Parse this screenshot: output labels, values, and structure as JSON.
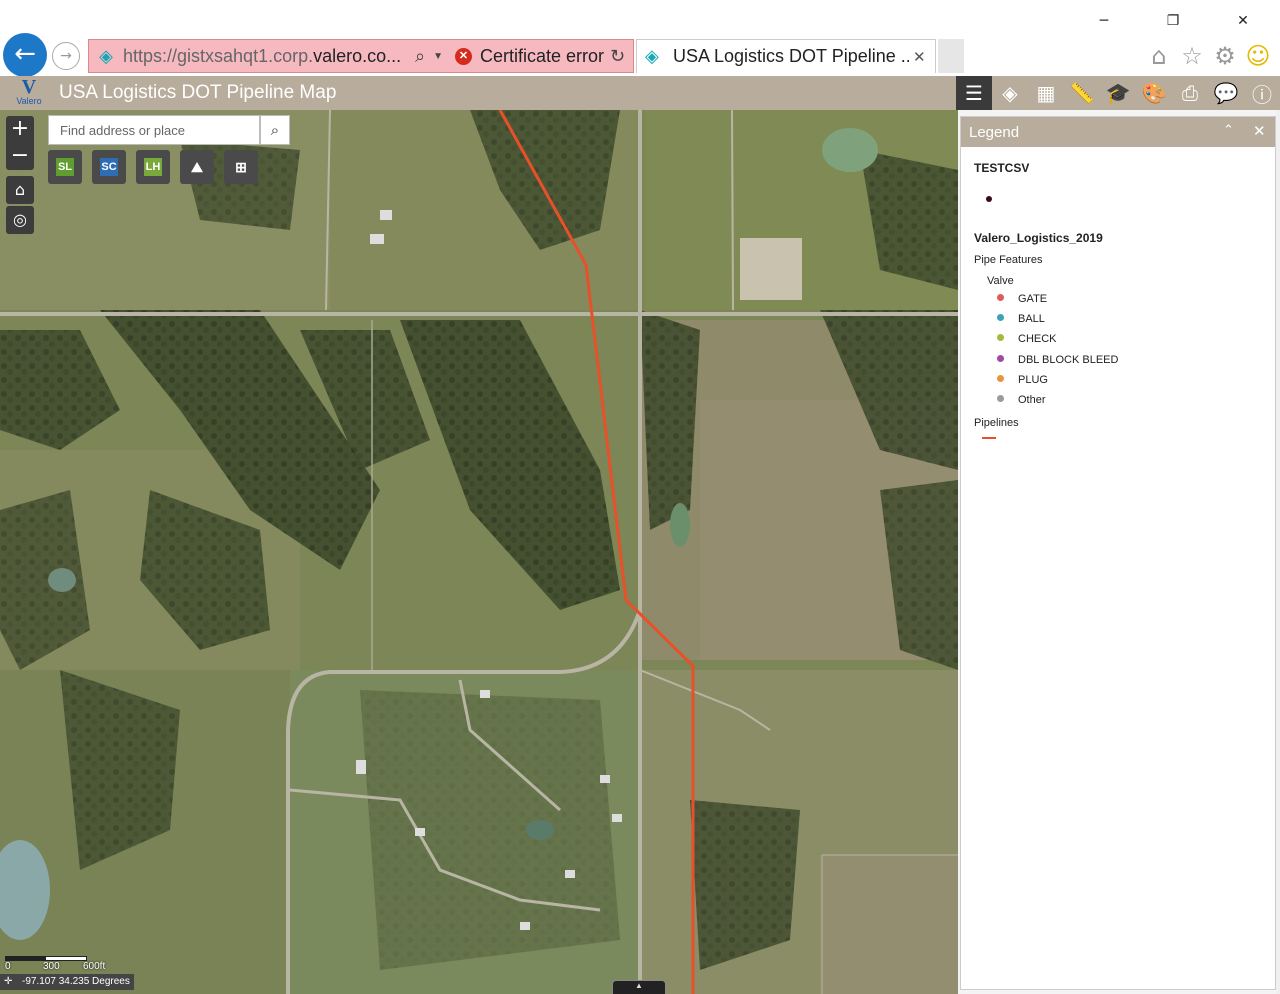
{
  "browser": {
    "window_controls": {
      "minimize": "─",
      "restore": "❐",
      "close": "✕"
    },
    "url_prefix": "https://gistxsahqt1.corp.",
    "url_domain": "valero.co...",
    "cert_error": "Certificate error",
    "tab_title": "USA Logistics DOT Pipeline ...",
    "icons": [
      "back-arrow-icon",
      "forward-arrow-icon",
      "site-favicon",
      "search-icon",
      "dropdown-icon",
      "certificate-error-icon",
      "refresh-icon",
      "tab-close-icon",
      "home-icon",
      "favorites-star-icon",
      "settings-gear-icon",
      "feedback-smiley-icon"
    ]
  },
  "app": {
    "logo_text": "Valero",
    "title": "USA Logistics DOT Pipeline Map",
    "header_color": "#b8ad9d",
    "toolbar_icons": [
      "legend-list-icon",
      "layers-icon",
      "basemap-grid-icon",
      "measure-ruler-icon",
      "learn-icon",
      "palette-icon",
      "print-icon",
      "comment-icon",
      "info-icon"
    ]
  },
  "map": {
    "search_placeholder": "Find address or place",
    "widgets": [
      {
        "label": "SL",
        "color": "#5f9e2f"
      },
      {
        "label": "SC",
        "color": "#2e6db3"
      },
      {
        "label": "LH",
        "color": "#7aa83a"
      },
      {
        "label": "",
        "color": "#ffffff"
      },
      {
        "label": "",
        "color": "#ffffff"
      }
    ],
    "scale_labels": [
      "0",
      "300",
      "600ft"
    ],
    "coordinates": "-97.107 34.235 Degrees",
    "pipeline_color": "#e8502a"
  },
  "legend": {
    "title": "Legend",
    "layers": [
      {
        "name": "TESTCSV",
        "symbol_color": "#3a0a14"
      },
      {
        "name": "Valero_Logistics_2019"
      }
    ],
    "pipe_features_label": "Pipe Features",
    "valve_label": "Valve",
    "valves": [
      {
        "label": "GATE",
        "color": "#e05a5a"
      },
      {
        "label": "BALL",
        "color": "#3aa3b8"
      },
      {
        "label": "CHECK",
        "color": "#a8b83a"
      },
      {
        "label": "DBL BLOCK BLEED",
        "color": "#a04aa8"
      },
      {
        "label": "PLUG",
        "color": "#e8943a"
      },
      {
        "label": "Other",
        "color": "#9a9a9a"
      }
    ],
    "pipelines_label": "Pipelines",
    "pipelines_color": "#e8502a"
  }
}
